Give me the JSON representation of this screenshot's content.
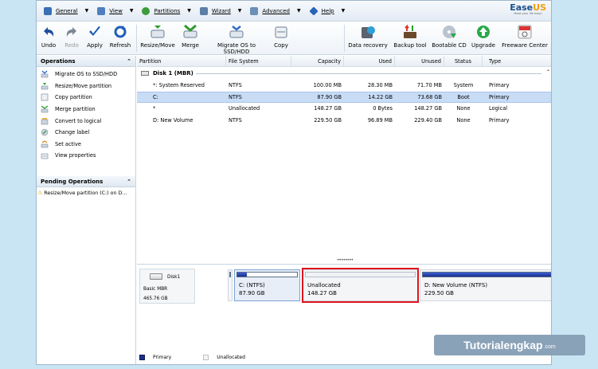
{
  "menu": [
    {
      "label": "General",
      "icon": "general-icon",
      "color": "#3a6fb5"
    },
    {
      "label": "View",
      "icon": "view-icon",
      "color": "#4f7fbf"
    },
    {
      "label": "Partitions",
      "icon": "partitions-icon",
      "color": "#3c9c3c"
    },
    {
      "label": "Wizard",
      "icon": "wizard-icon",
      "color": "#5b7fa8"
    },
    {
      "label": "Advanced",
      "icon": "advanced-icon",
      "color": "#6b8fb8"
    },
    {
      "label": "Help",
      "icon": "help-icon",
      "color": "#2a64b8"
    }
  ],
  "logo": {
    "main": "EaseUS",
    "tagline": "Make your life easy!"
  },
  "toolbar": {
    "undo": "Undo",
    "redo": "Redo",
    "apply": "Apply",
    "refresh": "Refresh",
    "resize_move": "Resize/Move",
    "merge": "Merge",
    "migrate": "Migrate OS to SSD/HDD",
    "copy": "Copy",
    "data_recovery": "Data recovery",
    "backup_tool": "Backup tool",
    "bootable_cd": "Bootable CD",
    "upgrade": "Upgrade",
    "freeware_center": "Freeware Center"
  },
  "operations": {
    "title": "Operations",
    "items": [
      "Migrate OS to SSD/HDD",
      "Resize/Move partition",
      "Copy partition",
      "Merge partition",
      "Convert to logical",
      "Change label",
      "Set active",
      "View properties"
    ]
  },
  "pending": {
    "title": "Pending Operations",
    "items": [
      "Resize/Move partition (C:) on D..."
    ]
  },
  "table": {
    "headers": [
      "Partition",
      "File System",
      "Capacity",
      "Used",
      "Unused",
      "Status",
      "Type"
    ],
    "disk_label": "Disk 1 (MBR)",
    "rows": [
      {
        "partition": "*: System Reserved",
        "fs": "NTFS",
        "capacity": "100.00 MB",
        "used": "28.30 MB",
        "unused": "71.70 MB",
        "status": "System",
        "type": "Primary"
      },
      {
        "partition": "C:",
        "fs": "NTFS",
        "capacity": "87.90 GB",
        "used": "14.22 GB",
        "unused": "73.68 GB",
        "status": "Boot",
        "type": "Primary"
      },
      {
        "partition": "*",
        "fs": "Unallocated",
        "capacity": "148.27 GB",
        "used": "0 Bytes",
        "unused": "148.27 GB",
        "status": "None",
        "type": "Logical"
      },
      {
        "partition": "D: New Volume",
        "fs": "NTFS",
        "capacity": "229.50 GB",
        "used": "96.89 MB",
        "unused": "229.40 GB",
        "status": "None",
        "type": "Primary"
      }
    ]
  },
  "diskmap": {
    "disk_name": "Disk1",
    "disk_type": "Basic MBR",
    "disk_size": "465.76 GB",
    "partitions": [
      {
        "name": "C: (NTFS)",
        "size": "87.90 GB",
        "used_fraction": 0.16
      },
      {
        "name": "Unallocated",
        "size": "148.27 GB",
        "used_fraction": 0
      },
      {
        "name": "D: New Volume (NTFS)",
        "size": "229.50 GB",
        "used_fraction": 1.0
      }
    ]
  },
  "legend": {
    "primary": "Primary",
    "unallocated": "Unallocated"
  },
  "colors": {
    "accent_selected": "#c8dcf6",
    "primary_bar": "#1c2f8a",
    "highlight": "#e0131d"
  },
  "watermark": {
    "main": "Tutorialengkap",
    "domain": ".com"
  }
}
